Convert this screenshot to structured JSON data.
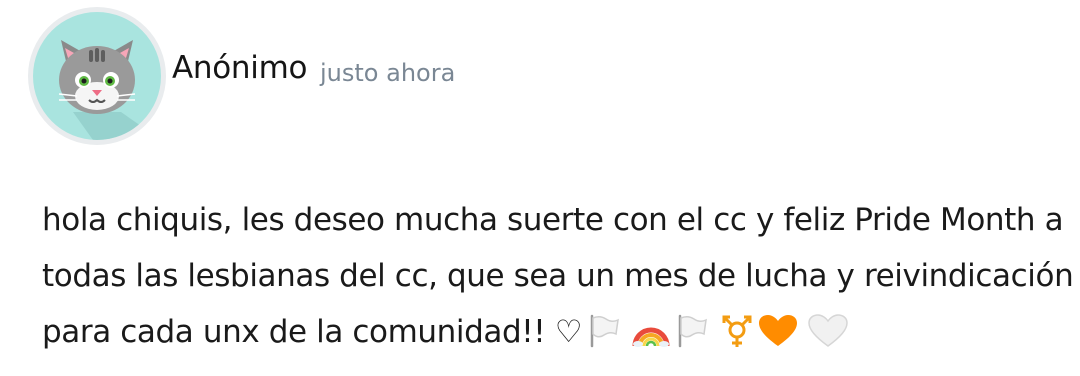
{
  "post": {
    "author": "Anónimo",
    "timestamp": "justo ahora",
    "avatar_icon": "gray-cat-avatar",
    "message_lines": [
      "hola chiquis, les deseo mucha suerte con el cc y feliz Pride Month a",
      "todas las lesbianas del cc, que sea un mes de lucha y reivindicación",
      "para cada unx de la comunidad!! ♡"
    ],
    "emojis": [
      "white-flag",
      "rainbow",
      "white-flag",
      "transgender-symbol",
      "orange-heart",
      "white-heart"
    ]
  },
  "colors": {
    "avatar_bg": "#a9e4df",
    "avatar_ring": "#e9ecee",
    "timestamp": "#7a8794",
    "trans_symbol": "#f39c12",
    "orange_heart": "#ff8c00"
  }
}
